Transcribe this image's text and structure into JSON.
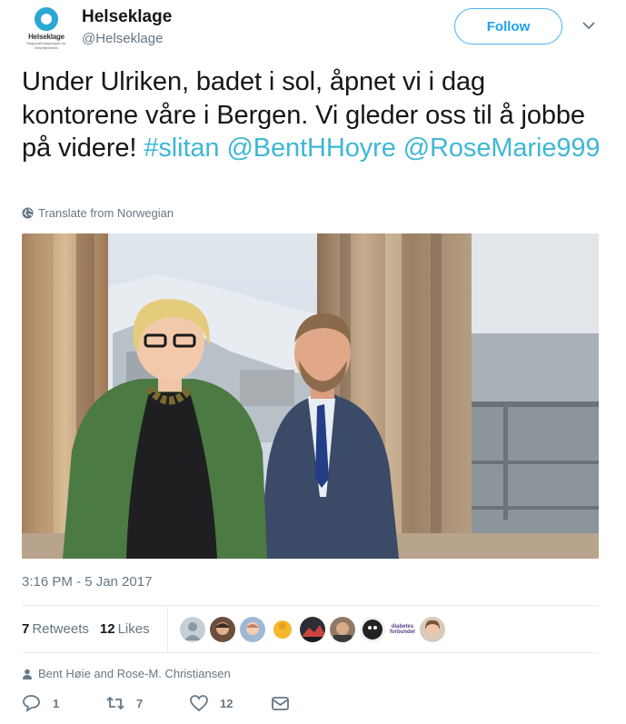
{
  "account": {
    "display_name": "Helseklage",
    "screen_name": "@Helseklage",
    "avatar_name": "Helseklage",
    "avatar_subtitle": "Nasjonalt klageorgan for helsetjenesten"
  },
  "follow_label": "Follow",
  "tweet": {
    "text_plain": "Under Ulriken, badet i sol, åpnet vi i dag kontorene våre i Bergen. Vi gleder oss til å jobbe på videre! ",
    "hashtag": "#slitan",
    "mention_1": "@BentHHoyre",
    "mention_2": "@RoseMarie999"
  },
  "translate_label": "Translate from Norwegian",
  "timestamp": "3:16 PM - 5 Jan 2017",
  "stats": {
    "retweets_count": "7",
    "retweets_label": "Retweets",
    "likes_count": "12",
    "likes_label": "Likes"
  },
  "likers_badge_text": "diabetes forbundet",
  "context_text": "Bent Høie and Rose-M. Christiansen",
  "actions": {
    "reply_count": "1",
    "retweet_count": "7",
    "like_count": "12"
  },
  "colors": {
    "link": "#3fb7d6",
    "follow": "#1da1f2",
    "secondary_text": "#657786"
  },
  "icons": [
    "chevron-down-icon",
    "globe-icon",
    "person-icon",
    "reply-icon",
    "retweet-icon",
    "heart-icon",
    "message-icon"
  ]
}
